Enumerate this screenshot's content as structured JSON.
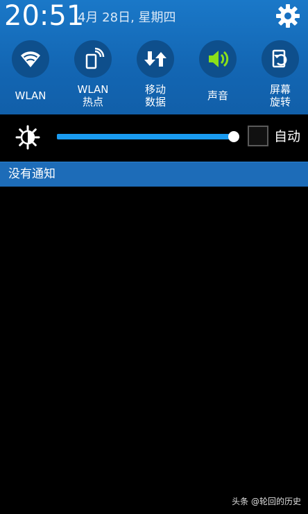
{
  "status": {
    "time": "20:51",
    "date": "4月 28日, 星期四"
  },
  "quick_settings": [
    {
      "label": "WLAN",
      "icon": "wifi-icon",
      "active": false
    },
    {
      "label": "WLAN\n热点",
      "icon": "hotspot-icon",
      "active": false
    },
    {
      "label": "移动\n数据",
      "icon": "mobile-data-icon",
      "active": false
    },
    {
      "label": "声音",
      "icon": "sound-icon",
      "active": true
    },
    {
      "label": "屏幕\n旋转",
      "icon": "screen-rotation-icon",
      "active": false
    }
  ],
  "brightness": {
    "level": 1.0,
    "auto_label": "自动",
    "auto_checked": false
  },
  "notifications": {
    "empty_text": "没有通知"
  },
  "watermark": "头条 @轮回的历史",
  "colors": {
    "panel": "#1366b3",
    "tile_circle": "#0e4f8c",
    "active_icon": "#8be01a",
    "icon": "#ffffff",
    "slider": "#1a9bf0",
    "notif_bar": "#1d6cb8"
  }
}
